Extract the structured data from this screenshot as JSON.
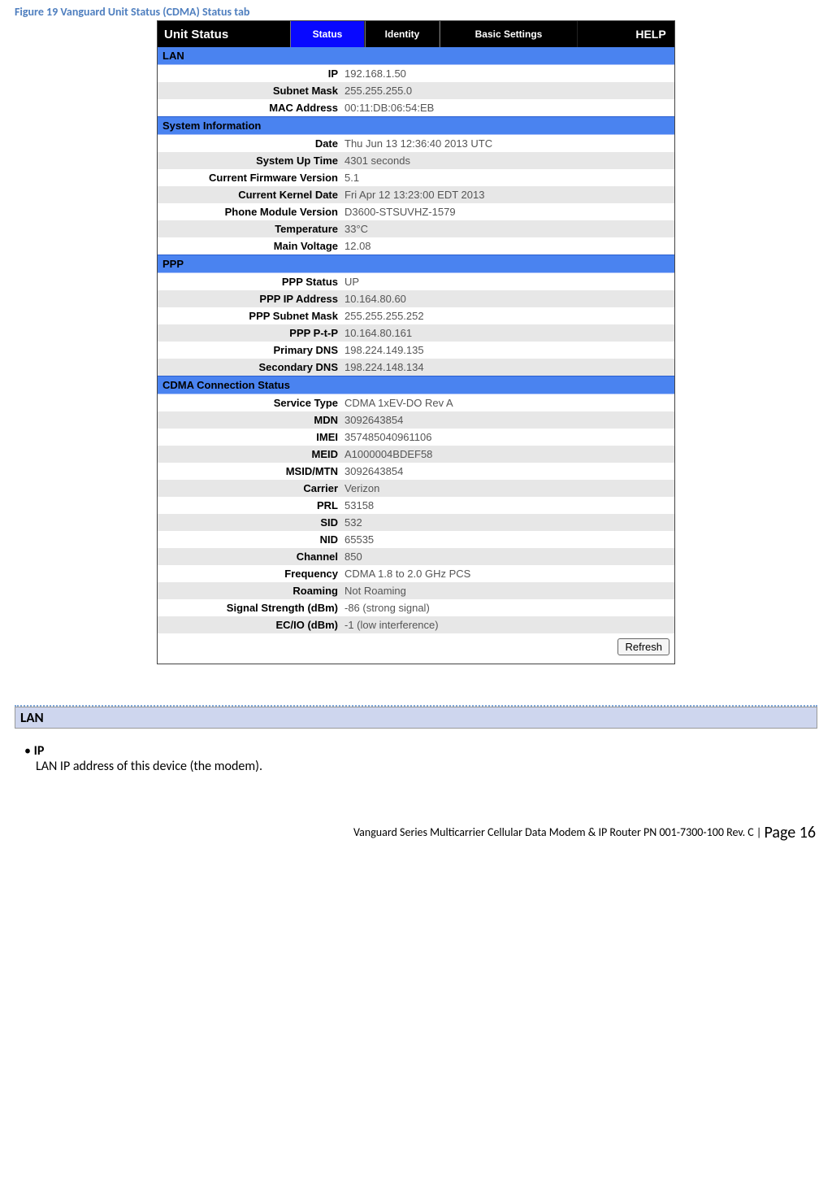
{
  "figure_caption": "Figure 19 Vanguard Unit Status (CDMA) Status tab",
  "tabbar": {
    "title": "Unit Status",
    "tabs": [
      {
        "label": "Status",
        "active": true
      },
      {
        "label": "Identity",
        "active": false
      },
      {
        "label": "Basic Settings",
        "active": false
      }
    ],
    "help": "HELP"
  },
  "sections": [
    {
      "header": "LAN",
      "rows": [
        {
          "label": "IP",
          "value": "192.168.1.50"
        },
        {
          "label": "Subnet Mask",
          "value": "255.255.255.0"
        },
        {
          "label": "MAC Address",
          "value": "00:11:DB:06:54:EB"
        }
      ]
    },
    {
      "header": "System Information",
      "rows": [
        {
          "label": "Date",
          "value": "Thu Jun 13 12:36:40 2013 UTC"
        },
        {
          "label": "System Up Time",
          "value": "4301 seconds"
        },
        {
          "label": "Current Firmware Version",
          "value": "5.1"
        },
        {
          "label": "Current Kernel Date",
          "value": "Fri Apr 12 13:23:00 EDT 2013"
        },
        {
          "label": "Phone Module Version",
          "value": "D3600-STSUVHZ-1579"
        },
        {
          "label": "Temperature",
          "value": "33°C"
        },
        {
          "label": "Main Voltage",
          "value": "12.08"
        }
      ]
    },
    {
      "header": "PPP",
      "rows": [
        {
          "label": "PPP Status",
          "value": "UP"
        },
        {
          "label": "PPP IP Address",
          "value": "10.164.80.60"
        },
        {
          "label": "PPP Subnet Mask",
          "value": "255.255.255.252"
        },
        {
          "label": "PPP P-t-P",
          "value": "10.164.80.161"
        },
        {
          "label": "Primary DNS",
          "value": "198.224.149.135"
        },
        {
          "label": "Secondary DNS",
          "value": "198.224.148.134"
        }
      ]
    },
    {
      "header": "CDMA Connection Status",
      "rows": [
        {
          "label": "Service Type",
          "value": "CDMA 1xEV-DO Rev A"
        },
        {
          "label": "MDN",
          "value": "3092643854"
        },
        {
          "label": "IMEI",
          "value": "357485040961106"
        },
        {
          "label": "MEID",
          "value": "A1000004BDEF58"
        },
        {
          "label": "MSID/MTN",
          "value": "3092643854"
        },
        {
          "label": "Carrier",
          "value": "Verizon"
        },
        {
          "label": "PRL",
          "value": "53158"
        },
        {
          "label": "SID",
          "value": "532"
        },
        {
          "label": "NID",
          "value": "65535"
        },
        {
          "label": "Channel",
          "value": "850"
        },
        {
          "label": "Frequency",
          "value": "CDMA 1.8 to 2.0 GHz PCS"
        },
        {
          "label": "Roaming",
          "value": "Not Roaming"
        },
        {
          "label": "Signal Strength (dBm)",
          "value": "-86 (strong signal)"
        },
        {
          "label": "EC/IO (dBm)",
          "value": "-1 (low interference)"
        }
      ]
    }
  ],
  "refresh_label": "Refresh",
  "doc": {
    "section_title": "LAN",
    "bullet_title": "IP",
    "bullet_body": "LAN IP address of this device (the modem)."
  },
  "footer": {
    "line": "Vanguard Series Multicarrier Cellular Data Modem & IP Router PN 001-7300-100 Rev. C",
    "sep": " | ",
    "page_word": "Page ",
    "page_num": "16"
  }
}
